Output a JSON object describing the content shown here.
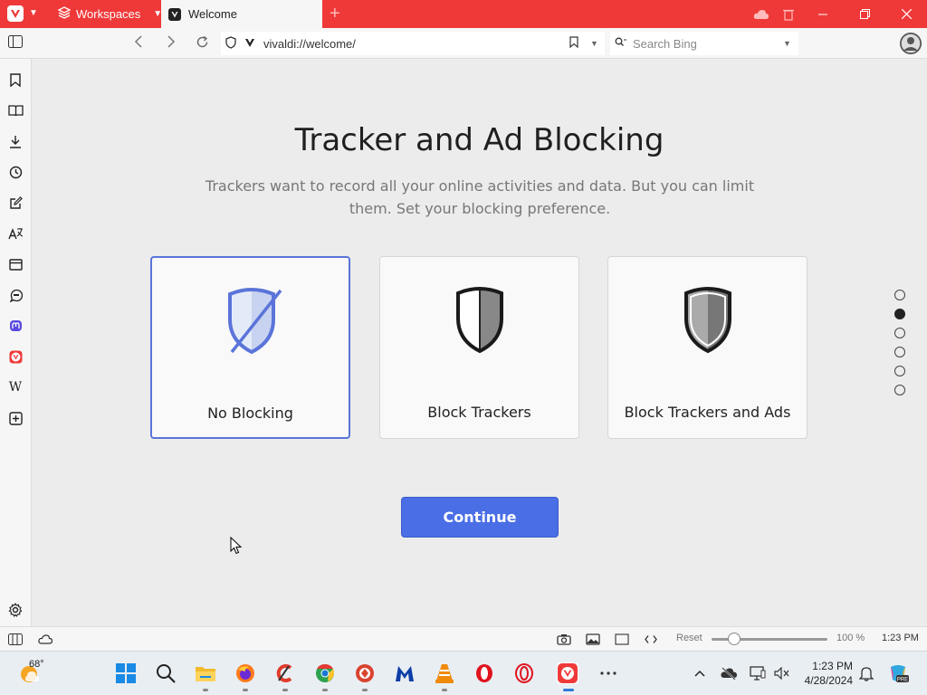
{
  "tabbar": {
    "workspaces_label": "Workspaces",
    "active_tab_title": "Welcome",
    "new_tab_label": "+",
    "accent": "#ef3939"
  },
  "addressbar": {
    "url": "vivaldi://welcome/",
    "search_placeholder": "Search Bing"
  },
  "sidepanel": {
    "icons": [
      "bookmark-icon",
      "reading-list-icon",
      "download-icon",
      "history-icon",
      "notes-icon",
      "translate-icon",
      "window-icon",
      "feed-icon",
      "mastodon-icon",
      "vivaldi-icon",
      "wikipedia-icon",
      "add-panel-icon",
      "settings-icon"
    ]
  },
  "main": {
    "title": "Tracker and Ad Blocking",
    "subtitle": "Trackers want to record all your online activities and data. But you can limit them. Set your blocking preference.",
    "options": [
      {
        "label": "No Blocking",
        "selected": true
      },
      {
        "label": "Block Trackers",
        "selected": false
      },
      {
        "label": "Block Trackers and Ads",
        "selected": false
      }
    ],
    "continue_label": "Continue",
    "steps_total": 6,
    "step_active": 2,
    "selected_color": "#5a74d9",
    "button_color": "#4a6ee6"
  },
  "statusbar": {
    "reset_label": "Reset",
    "zoom_label": "100 %",
    "time": "1:23 PM"
  },
  "taskbar": {
    "weather_temp": "68°",
    "clock_time": "1:23 PM",
    "clock_date": "4/28/2024",
    "apps": [
      "windows-start-icon",
      "search-icon",
      "file-explorer-icon",
      "firefox-icon",
      "ccleaner-icon",
      "chrome-icon",
      "app-icon",
      "malwarebytes-icon",
      "vlc-icon",
      "opera-icon",
      "opera-gx-icon",
      "vivaldi-icon",
      "more-icon"
    ],
    "copilot_badge": "PRE"
  }
}
